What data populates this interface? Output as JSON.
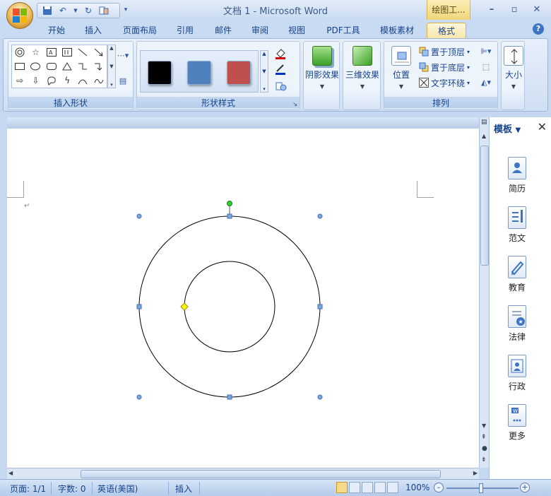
{
  "window": {
    "title": "文档 1 - Microsoft Word",
    "context_tab_title": "绘图工...",
    "controls": [
      "minimize",
      "maximize",
      "close"
    ]
  },
  "tabs": [
    {
      "label": "开始"
    },
    {
      "label": "插入"
    },
    {
      "label": "页面布局"
    },
    {
      "label": "引用"
    },
    {
      "label": "邮件"
    },
    {
      "label": "审阅"
    },
    {
      "label": "视图"
    },
    {
      "label": "PDF工具"
    },
    {
      "label": "模板素材"
    },
    {
      "label": "格式",
      "active": true
    }
  ],
  "ribbon": {
    "insert_shapes": {
      "label": "插入形状"
    },
    "shape_styles": {
      "label": "形状样式",
      "swatches": [
        "#000000",
        "#4f81bd",
        "#c0504d"
      ]
    },
    "shadow_effects": {
      "label": "阴影效果"
    },
    "threed_effects": {
      "label": "三维效果"
    },
    "arrange": {
      "label": "排列",
      "position": "位置",
      "bring_to_front": "置于顶层",
      "send_to_back": "置于底层",
      "text_wrap": "文字环绕"
    },
    "size": {
      "label": "大小"
    }
  },
  "task_pane": {
    "title": "模板",
    "items": [
      {
        "label": "简历",
        "icon": "resume-icon"
      },
      {
        "label": "范文",
        "icon": "sample-essay-icon"
      },
      {
        "label": "教育",
        "icon": "education-icon"
      },
      {
        "label": "法律",
        "icon": "law-icon"
      },
      {
        "label": "行政",
        "icon": "admin-icon"
      },
      {
        "label": "更多",
        "icon": "more-icon"
      }
    ]
  },
  "status_bar": {
    "page": "页面: 1/1",
    "word_count": "字数: 0",
    "language": "英语(美国)",
    "mode": "插入",
    "zoom": "100%"
  },
  "colors": {
    "ribbon_bg": "#dbe7f6",
    "accent": "#15428b",
    "selection_handle": "#4f81bd",
    "rotation_handle": "#33cc33",
    "adjust_handle": "#ffff00"
  }
}
